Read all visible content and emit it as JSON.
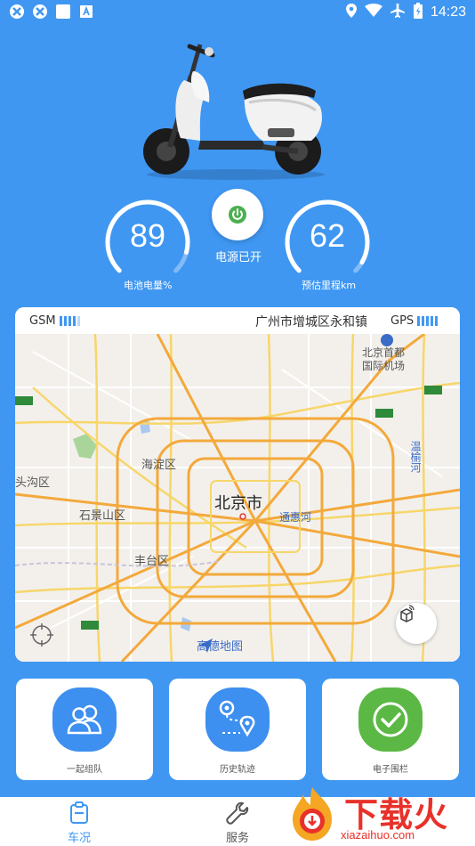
{
  "status_bar": {
    "time": "14:23"
  },
  "scooter": {
    "image": "electric-scooter"
  },
  "battery": {
    "value": "89",
    "label": "电池电量%",
    "percent": 89
  },
  "power": {
    "label": "电源已开",
    "color": "#4caf50"
  },
  "range": {
    "value": "62",
    "label": "预估里程km"
  },
  "map": {
    "gsm_label": "GSM",
    "gps_label": "GPS",
    "address": "广州市增城区永和镇",
    "labels": {
      "city": "北京市",
      "haidian": "海淀区",
      "shijingshan": "石景山区",
      "fengtai": "丰台区",
      "mentougou": "头沟区",
      "airport": "北京首都\n国际机场",
      "tonghui": "通惠河",
      "wenyu": "温榆河"
    },
    "logo_text": "高德地图"
  },
  "tiles": [
    {
      "label": "一起组队",
      "color": "#3d8ff0"
    },
    {
      "label": "历史轨迹",
      "color": "#3d8ff0"
    },
    {
      "label": "电子围栏",
      "color": "#5bb845"
    }
  ],
  "nav": [
    {
      "label": "车况",
      "active": true
    },
    {
      "label": "服务",
      "active": false
    }
  ],
  "watermark": {
    "title": "下载火",
    "url": "xiazaihuo.com"
  },
  "colors": {
    "primary": "#3f97f2",
    "accent_red": "#e8312a"
  }
}
